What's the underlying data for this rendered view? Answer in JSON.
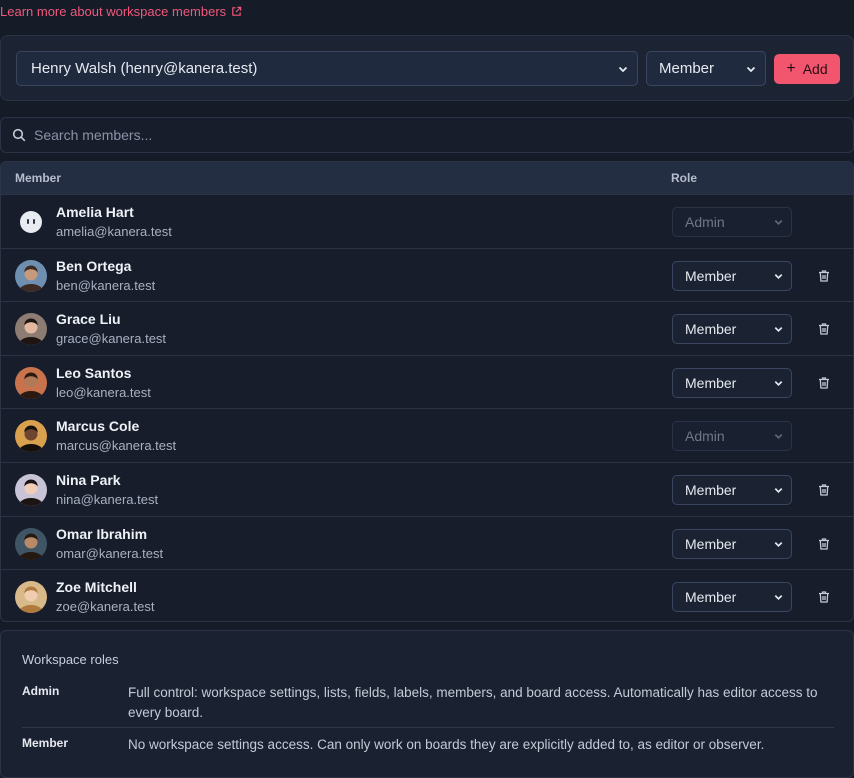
{
  "learn_link": "Learn more about workspace members",
  "add_form": {
    "user_value": "Henry Walsh (henry@kanera.test)",
    "role_value": "Member",
    "add_label": "Add"
  },
  "search": {
    "placeholder": "Search members..."
  },
  "table": {
    "col_member": "Member",
    "col_role": "Role",
    "rows": [
      {
        "name": "Amelia Hart",
        "email": "amelia@kanera.test",
        "role": "Admin",
        "editable": false,
        "avatar": "ghost-icon"
      },
      {
        "name": "Ben Ortega",
        "email": "ben@kanera.test",
        "role": "Member",
        "editable": true,
        "avatar": "photo"
      },
      {
        "name": "Grace Liu",
        "email": "grace@kanera.test",
        "role": "Member",
        "editable": true,
        "avatar": "photo"
      },
      {
        "name": "Leo Santos",
        "email": "leo@kanera.test",
        "role": "Member",
        "editable": true,
        "avatar": "photo"
      },
      {
        "name": "Marcus Cole",
        "email": "marcus@kanera.test",
        "role": "Admin",
        "editable": false,
        "avatar": "photo"
      },
      {
        "name": "Nina Park",
        "email": "nina@kanera.test",
        "role": "Member",
        "editable": true,
        "avatar": "photo"
      },
      {
        "name": "Omar Ibrahim",
        "email": "omar@kanera.test",
        "role": "Member",
        "editable": true,
        "avatar": "photo"
      },
      {
        "name": "Zoe Mitchell",
        "email": "zoe@kanera.test",
        "role": "Member",
        "editable": true,
        "avatar": "photo"
      }
    ]
  },
  "roles_info": {
    "title": "Workspace roles",
    "roles": [
      {
        "name": "Admin",
        "description": "Full control: workspace settings, lists, fields, labels, members, and board access. Automatically has editor access to every board."
      },
      {
        "name": "Member",
        "description": "No workspace settings access. Can only work on boards they are explicitly added to, as editor or observer."
      }
    ]
  },
  "colors": {
    "accent": "#f2566f",
    "link": "#f0587a",
    "background": "#161b28"
  }
}
